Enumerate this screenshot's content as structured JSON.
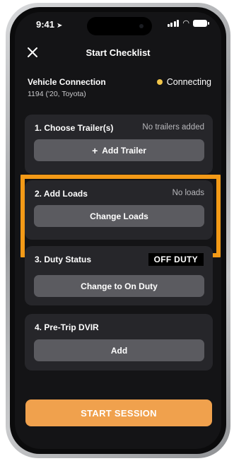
{
  "status_bar": {
    "time": "9:41"
  },
  "header": {
    "title": "Start Checklist"
  },
  "vehicle": {
    "title": "Vehicle Connection",
    "subtitle": "1194 ('20, Toyota)",
    "connection_status": "Connecting"
  },
  "cards": {
    "trailer": {
      "title": "1. Choose Trailer(s)",
      "meta": "No trailers added",
      "button_label": "Add Trailer"
    },
    "loads": {
      "title": "2. Add Loads",
      "meta": "No loads",
      "button_label": "Change Loads"
    },
    "duty": {
      "title": "3. Duty Status",
      "badge": "OFF DUTY",
      "button_label": "Change to On Duty"
    },
    "dvir": {
      "title": "4. Pre-Trip DVIR",
      "button_label": "Add"
    }
  },
  "footer": {
    "start_label": "START SESSION"
  },
  "colors": {
    "accent": "#f0a14d",
    "highlight": "#f39a17",
    "connecting_dot": "#f2c64a"
  }
}
